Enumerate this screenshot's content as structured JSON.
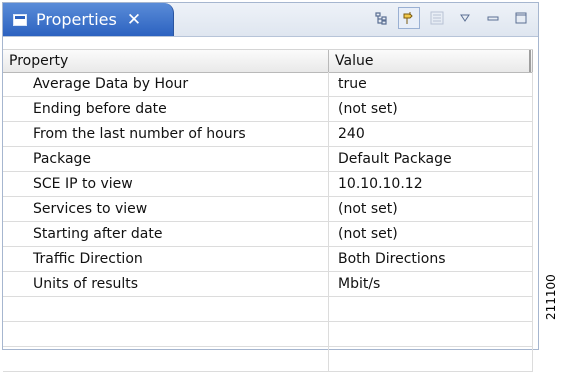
{
  "tab": {
    "title": "Properties",
    "close": "✕"
  },
  "toolbar": {
    "icons": [
      "tree-icon",
      "pin-icon",
      "filter-icon",
      "view-menu-icon",
      "minimize-icon",
      "maximize-icon"
    ]
  },
  "table": {
    "headers": {
      "property": "Property",
      "value": "Value"
    },
    "rows": [
      {
        "property": "Average Data by Hour",
        "value": "true"
      },
      {
        "property": "Ending before date",
        "value": "(not set)"
      },
      {
        "property": "From the last number of hours",
        "value": "240"
      },
      {
        "property": "Package",
        "value": "Default Package"
      },
      {
        "property": "SCE IP to view",
        "value": "10.10.10.12"
      },
      {
        "property": "Services to view",
        "value": "(not set)"
      },
      {
        "property": "Starting after date",
        "value": "(not set)"
      },
      {
        "property": "Traffic Direction",
        "value": "Both Directions"
      },
      {
        "property": "Units of results",
        "value": "Mbit/s"
      },
      {
        "property": "",
        "value": ""
      },
      {
        "property": "",
        "value": ""
      },
      {
        "property": "",
        "value": ""
      }
    ]
  },
  "figure_number": "211100",
  "colors": {
    "tab_active": "#2c62c0",
    "header_bg": "#e9e9e9",
    "border": "#a6b6cf"
  }
}
